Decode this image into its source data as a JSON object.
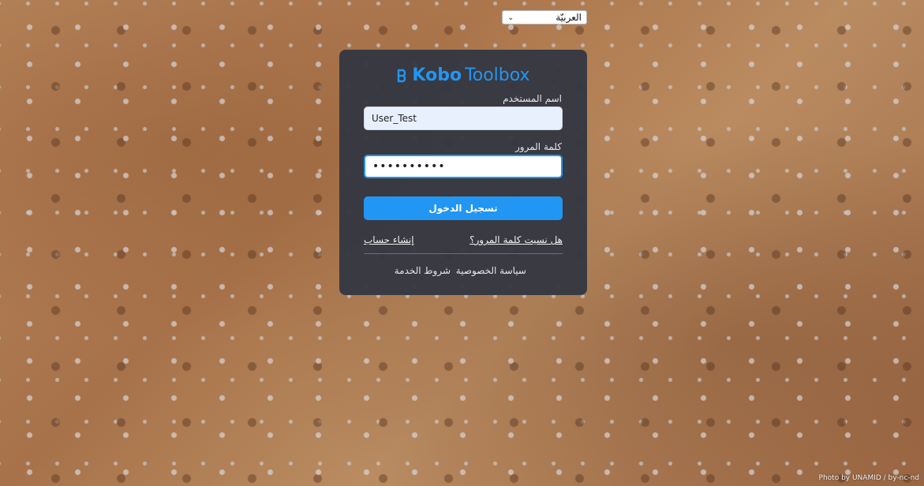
{
  "language_select": {
    "selected": "العربيّة"
  },
  "logo": {
    "kobo": "Kobo",
    "toolbox": "Toolbox",
    "brand_color": "#2196f3"
  },
  "form": {
    "username_label": "اسم المستخدم",
    "username_value": "User_Test",
    "password_label": "كلمة المرور",
    "password_value": "••••••••••",
    "login_button": "تسجيل الدخول"
  },
  "links": {
    "forgot_password": "هل نسيت كلمة المرور؟",
    "create_account": "إنشاء حساب",
    "privacy_policy": "سياسة الخصوصية",
    "terms_of_service": "شروط الخدمة"
  },
  "photo_credit": "Photo by UNAMID / by-nc-nd"
}
